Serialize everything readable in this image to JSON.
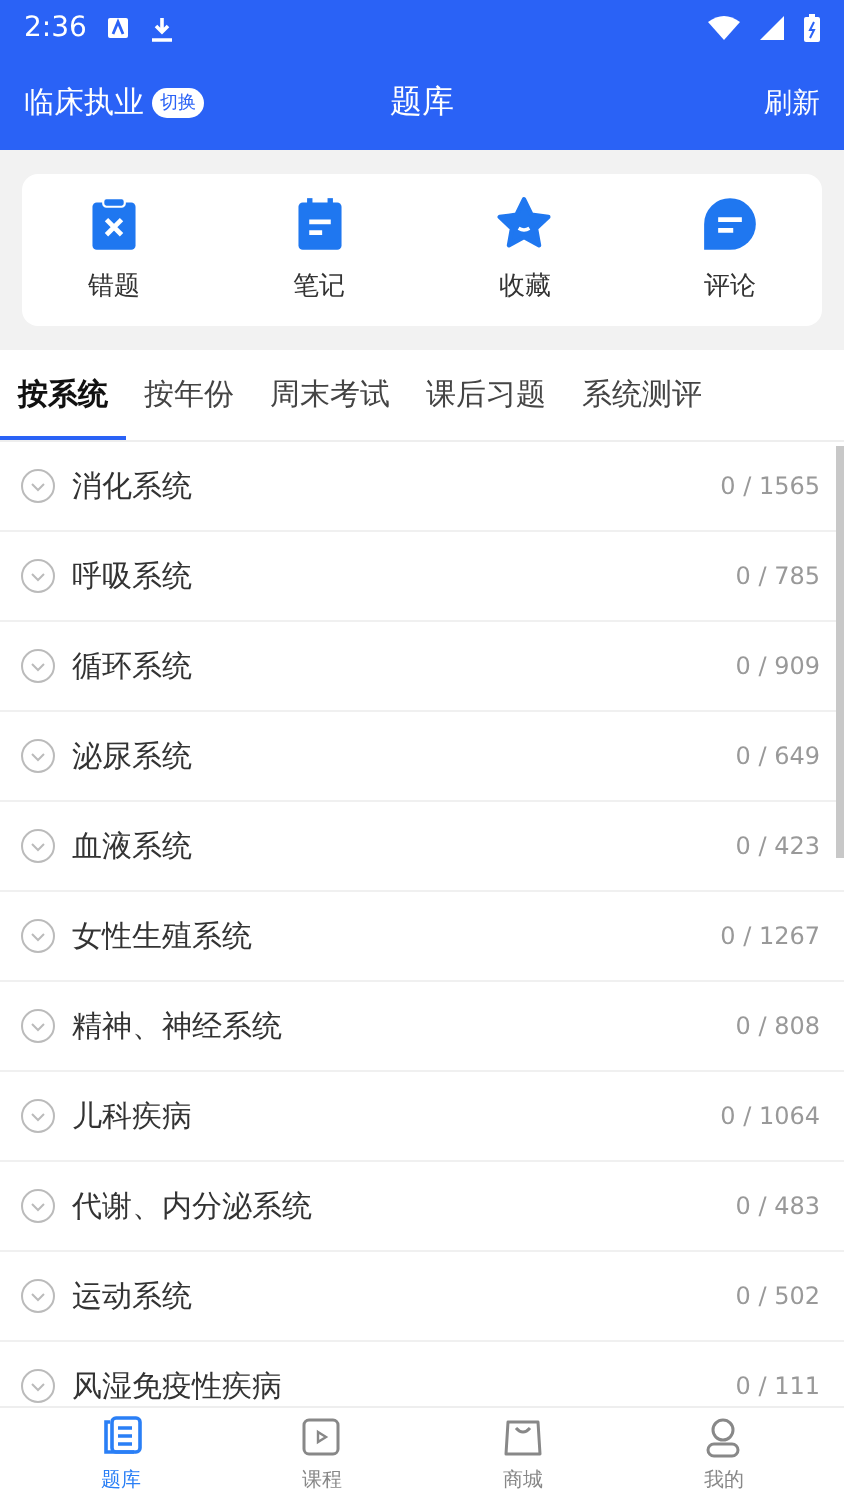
{
  "status_bar": {
    "time": "2:36"
  },
  "header": {
    "subject": "临床执业",
    "switch_badge": "切换",
    "title": "题库",
    "action": "刷新"
  },
  "shortcuts": [
    {
      "kind": "wrong",
      "label": "错题"
    },
    {
      "kind": "notes",
      "label": "笔记"
    },
    {
      "kind": "favorites",
      "label": "收藏"
    },
    {
      "kind": "comments",
      "label": "评论"
    }
  ],
  "tabs": [
    {
      "label": "按系统",
      "selected": true
    },
    {
      "label": "按年份",
      "selected": false
    },
    {
      "label": "周末考试",
      "selected": false
    },
    {
      "label": "课后习题",
      "selected": false
    },
    {
      "label": "系统测评",
      "selected": false
    }
  ],
  "topics": [
    {
      "name": "消化系统",
      "progress": "0 / 1565"
    },
    {
      "name": "呼吸系统",
      "progress": "0 / 785"
    },
    {
      "name": "循环系统",
      "progress": "0 / 909"
    },
    {
      "name": "泌尿系统",
      "progress": "0 / 649"
    },
    {
      "name": "血液系统",
      "progress": "0 / 423"
    },
    {
      "name": "女性生殖系统",
      "progress": "0 / 1267"
    },
    {
      "name": "精神、神经系统",
      "progress": "0 / 808"
    },
    {
      "name": "儿科疾病",
      "progress": "0 / 1064"
    },
    {
      "name": "代谢、内分泌系统",
      "progress": "0 / 483"
    },
    {
      "name": "运动系统",
      "progress": "0 / 502"
    },
    {
      "name": "风湿免疫性疾病",
      "progress": "0 / 111"
    }
  ],
  "bottom_nav": [
    {
      "kind": "bank",
      "label": "题库",
      "selected": true
    },
    {
      "kind": "course",
      "label": "课程",
      "selected": false
    },
    {
      "kind": "shop",
      "label": "商城",
      "selected": false
    },
    {
      "kind": "me",
      "label": "我的",
      "selected": false
    }
  ]
}
